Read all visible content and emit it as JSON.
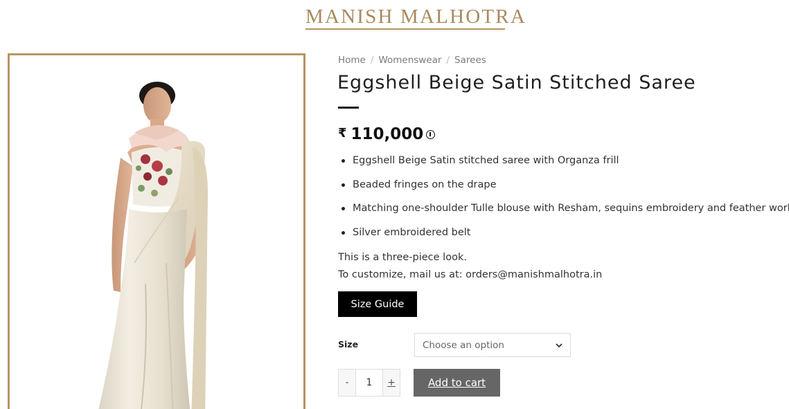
{
  "header": {
    "logo_text": "MANISH MALHOTRA"
  },
  "breadcrumb": {
    "items": [
      "Home",
      "Womenswear",
      "Sarees"
    ],
    "separator": "/"
  },
  "product": {
    "title": "Eggshell Beige Satin Stitched Saree",
    "currency_symbol": "₹",
    "price": "110,000",
    "features": [
      "Eggshell Beige Satin stitched saree with Organza frill",
      "Beaded fringes on the drape",
      "Matching one-shoulder Tulle blouse with Resham, sequins embroidery and feather work",
      "Silver embroidered belt"
    ],
    "description_lines": [
      "This is a three-piece look.",
      "To customize, mail us at: orders@manishmalhotra.in"
    ]
  },
  "actions": {
    "size_guide_label": "Size Guide",
    "size_label": "Size",
    "size_select_value": "Choose an option",
    "qty_minus": "-",
    "qty_value": "1",
    "qty_plus": "+",
    "add_to_cart_label": "Add to cart"
  },
  "colors": {
    "brand_gold": "#b89462",
    "button_black": "#000000",
    "cart_button_gray": "#666666"
  },
  "icons": {
    "price_info": "info-icon",
    "select_dropdown": "chevron-down-icon"
  }
}
